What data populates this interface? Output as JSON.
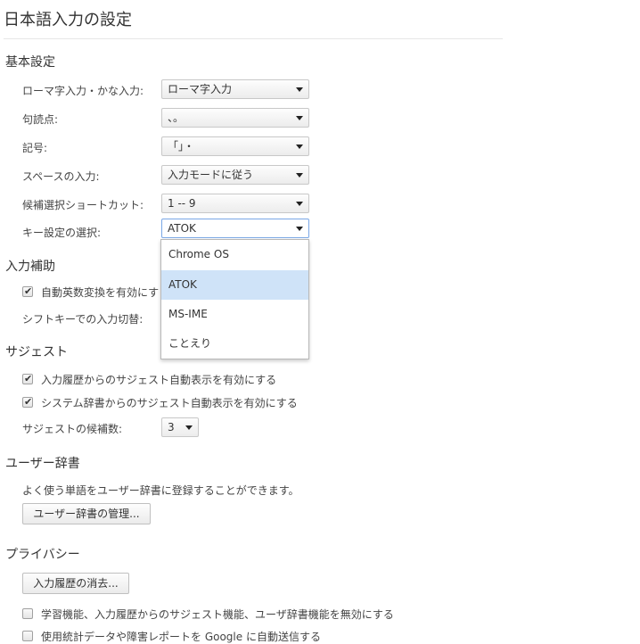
{
  "page_title": "日本語入力の設定",
  "basic": {
    "heading": "基本設定",
    "rows": [
      {
        "label": "ローマ字入力・かな入力:",
        "value": "ローマ字入力"
      },
      {
        "label": "句読点:",
        "value": "、。"
      },
      {
        "label": "記号:",
        "value": "「」・"
      },
      {
        "label": "スペースの入力:",
        "value": "入力モードに従う"
      },
      {
        "label": "候補選択ショートカット:",
        "value": "1 -- 9"
      },
      {
        "label": "キー設定の選択:",
        "value": "ATOK"
      }
    ],
    "keymap_options": [
      "Chrome OS",
      "ATOK",
      "MS-IME",
      "ことえり"
    ],
    "keymap_selected": "ATOK"
  },
  "assist": {
    "heading": "入力補助",
    "auto_alnum_label": "自動英数変換を有効にす",
    "auto_alnum_checked": true,
    "shift_label": "シフトキーでの入力切替:"
  },
  "suggest": {
    "heading": "サジェスト",
    "history_label": "入力履歴からのサジェスト自動表示を有効にする",
    "history_checked": true,
    "dict_label": "システム辞書からのサジェスト自動表示を有効にする",
    "dict_checked": true,
    "count_label": "サジェストの候補数:",
    "count_value": "3"
  },
  "user_dict": {
    "heading": "ユーザー辞書",
    "description": "よく使う単語をユーザー辞書に登録することができます。",
    "manage_button": "ユーザー辞書の管理..."
  },
  "privacy": {
    "heading": "プライバシー",
    "clear_button": "入力履歴の消去...",
    "disable_learning_label": "学習機能、入力履歴からのサジェスト機能、ユーザ辞書機能を無効にする",
    "disable_learning_checked": false,
    "send_stats_label": "使用統計データや障害レポートを Google に自動送信する",
    "send_stats_checked": false
  }
}
